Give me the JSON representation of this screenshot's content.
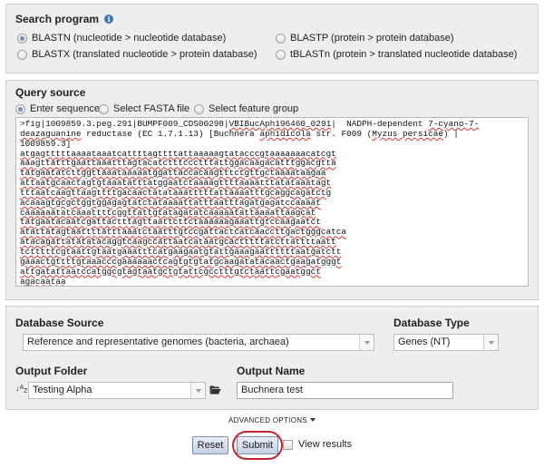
{
  "search_program": {
    "title": "Search program",
    "options": [
      {
        "label": "BLASTN (nucleotide > nucleotide database)",
        "selected": true
      },
      {
        "label": "BLASTX (translated nucleotide > protein database)",
        "selected": false
      },
      {
        "label": "BLASTP (protein > protein database)",
        "selected": false
      },
      {
        "label": "tBLASTn (protein > translated nucleotide database)",
        "selected": false
      }
    ]
  },
  "query_source": {
    "title": "Query source",
    "options": [
      {
        "label": "Enter sequence",
        "selected": true
      },
      {
        "label": "Select FASTA file",
        "selected": false
      },
      {
        "label": "Select feature group",
        "selected": false
      }
    ],
    "header_line1_prefix": ">fig|1009859.3.peg.291|BUMPF009_CDS00298|",
    "header_line1_underlined": "VBIBucAph196460_0291",
    "header_line1_mid": "|  NADPH-dependent ",
    "header_line1_underlined2": "7-cyano-7-",
    "header_line2_underlined": "deazaguanine",
    "header_line2_mid": " reductase (EC 1.7.1.13) [Buchnera ",
    "header_line2_underlined2": "aphidicola",
    "header_line2_mid2": " str. F009 (",
    "header_line2_underlined3": "Myzus persicae",
    "header_line2_end": ") |",
    "header_line3": "1009859.3]",
    "sequence_lines": [
      "atgagtttttaaaataaatcattttagttttattaaaaagtatacccgtaaaaaaacatcgt",
      "aaagttatttgaattaaatttagtacatctttccctttattggacaagacatttggacgtta",
      "tatgaatatcttggttaaataaaaatggattaccacaagtttctgttgctaaaataagaa",
      "attaatgcaactagtgtaaatatttatggaatctaaaagttttaaaatttatataaatagt",
      "tttaatcaagttaagttttgacaactatataaatttttattaaaatttgcaggcagatctg",
      "acaaagtgcgctggtggagagtatctataaaattatttaatttagatgagatccaaaat",
      "caaaaaatatcaaattttcggttattgtatagatatcaaaaatattaaaattaagcat",
      "tatgaatacaatcgattactttagttaattcttctaaaaaagaaattgtccaagaatct",
      "atattatagtaattttatttaaatctaatttgtccgattactcatcaaccttgactgggcatca",
      "atacagattatatatacaggtcaagccattaatcataatgcactttttatcttattttaatt",
      "tctttttcgtaattgtaatgaaatttcatgaagaatgtattgaaagaattttttaatgatctt",
      "gaaactgttttgtaaacccgaaaaaactcagtgtgtatgcaagatatacaactgaagatgggt",
      "attgatattaatccatggcgtagtaatgctgtattcgcctttgtctaattcgaatggct",
      "agacaataa"
    ]
  },
  "database": {
    "source_label": "Database Source",
    "source_value": "Reference and representative genomes (bacteria, archaea)",
    "type_label": "Database Type",
    "type_value": "Genes (NT)",
    "output_folder_label": "Output Folder",
    "output_folder_value": "Testing Alpha",
    "output_name_label": "Output Name",
    "output_name_value": "Buchnera test"
  },
  "advanced_options_label": "ADVANCED OPTIONS",
  "buttons": {
    "reset_label": "Reset",
    "submit_label": "Submit",
    "view_results_label": "View results"
  },
  "icons": {
    "info": "info-icon",
    "sort": "sort-az-icon",
    "folder": "folder-open-icon"
  },
  "colors": {
    "panel_bg": "#eeeeee",
    "button_border": "#7d8fb0",
    "highlight_ring": "#c0262e",
    "info_icon": "#3d73b8"
  }
}
